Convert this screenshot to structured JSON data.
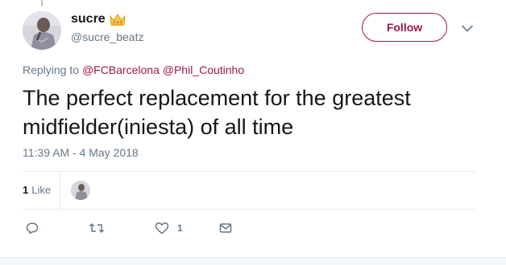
{
  "user": {
    "display_name": "sucre",
    "handle": "@sucre_beatz",
    "badge_icon": "crown-icon"
  },
  "follow_button": {
    "label": "Follow"
  },
  "menu": {
    "icon": "chevron-down-icon"
  },
  "reply_context": {
    "prefix": "Replying to",
    "mentions": [
      "@FCBarcelona",
      "@Phil_Coutinho"
    ]
  },
  "tweet": {
    "text": "The perfect replacement for the greatest midfielder(iniesta) of all time",
    "timestamp": "11:39 AM - 4 May 2018"
  },
  "stats": {
    "likes_count": "1",
    "likes_label": "Like"
  },
  "actions": {
    "reply_icon": "reply-icon",
    "retweet_icon": "retweet-icon",
    "like_icon": "heart-icon",
    "like_count": "1",
    "dm_icon": "direct-message-icon"
  },
  "colors": {
    "accent": "#a0154e",
    "text": "#14171a",
    "muted": "#657786",
    "divider": "#e6ecf0",
    "crown": "#f5c542"
  }
}
